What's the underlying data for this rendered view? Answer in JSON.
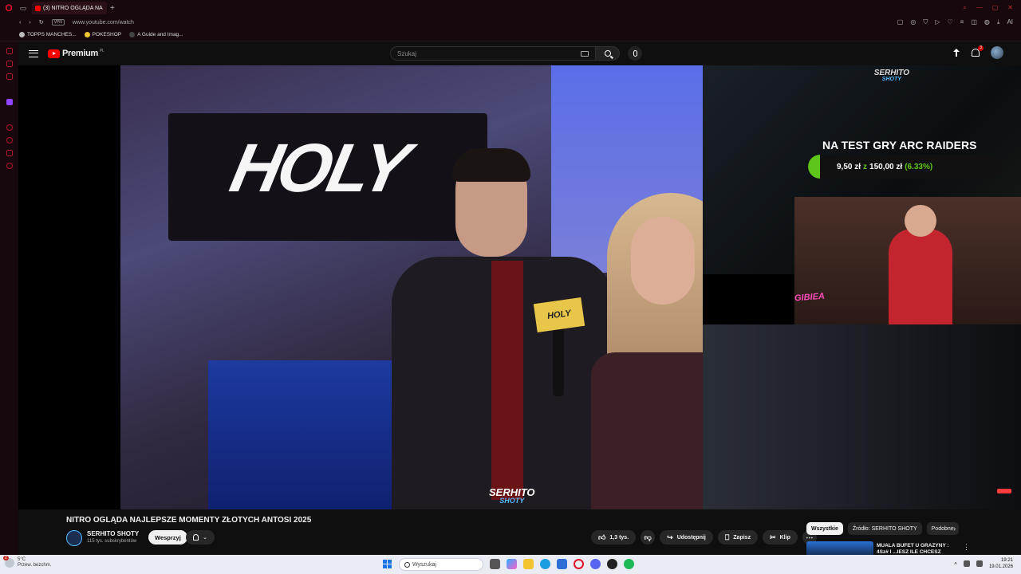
{
  "browser": {
    "tab_title": "(3) NITRO OGLĄDA NA",
    "url": "www.youtube.com/watch",
    "vpn_label": "VPN",
    "bookmarks": [
      "TOPPS MANCHES...",
      "POKESHOP",
      "A Guide and Imag..."
    ],
    "ai_label": "AI"
  },
  "yt": {
    "logo_text": "Premium",
    "region": "PL",
    "search_placeholder": "Szukaj",
    "notification_count": "3"
  },
  "video": {
    "sign_text": "HOLY",
    "mic_flag": "HOLY",
    "watermark_1": "SERHITO",
    "watermark_2": "SHOTY",
    "cam_brand_1": "SERHITO",
    "cam_brand_2": "SHOTY",
    "goal_title": "NA TEST GRY ARC RAIDERS",
    "goal_current": "9,50 zł",
    "goal_of": "z",
    "goal_target": "150,00 zł",
    "goal_percent": "(6.33%)",
    "goal_progress": 0.0633,
    "overlay_name": "GIBIEA"
  },
  "below": {
    "title": "NITRO OGLĄDA NAJLEPSZE MOMENTY ZŁOTYCH ANTOSI 2025",
    "channel_name": "SERHITO SHOTY",
    "subscribers": "115 tys. subskrybentów",
    "support_label": "Wesprzyj",
    "like_count": "1,3 tys.",
    "share_label": "Udostępnij",
    "save_label": "Zapisz",
    "clip_label": "Klip",
    "chips": [
      "Wszystkie",
      "Źródło: SERHITO SHOTY",
      "Podobne"
    ],
    "rec_title": "MUALA BUFET U GRAŻYNY : 4Sz# I ...IESZ ILE CHCESZ"
  },
  "taskbar": {
    "weather_temp": "5°C",
    "weather_desc": "Przew. bezchm.",
    "weather_badge": "2",
    "search_placeholder": "Wyszukaj",
    "time": "19:21",
    "date": "19.01.2026"
  }
}
